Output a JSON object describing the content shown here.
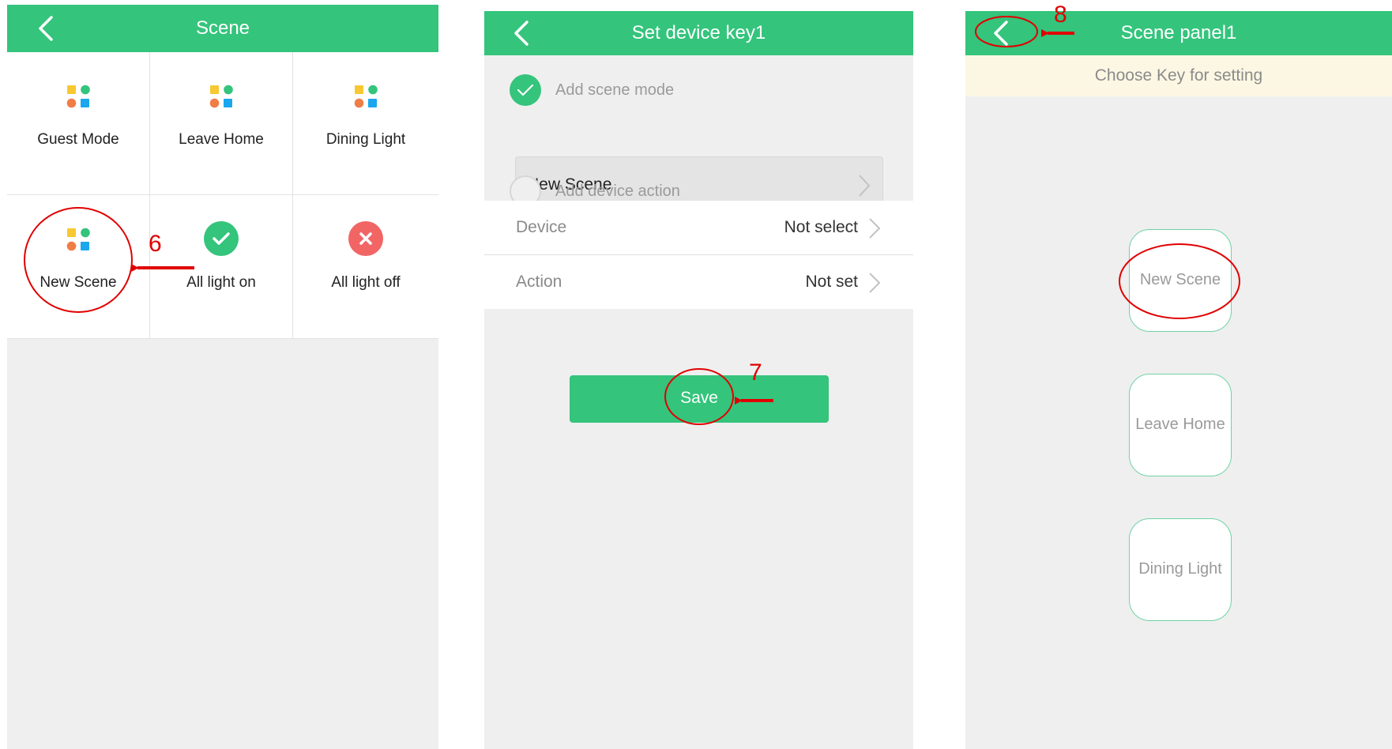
{
  "colors": {
    "brand_green": "#34c47c",
    "alert_red": "#f26565",
    "annotation_red": "#e00000",
    "hint_bg": "#fcf7e3"
  },
  "screen1": {
    "title": "Scene",
    "back_icon": "chevron-left-icon",
    "tiles": [
      {
        "label": "Guest Mode",
        "icon": "scene-grid-icon"
      },
      {
        "label": "Leave Home",
        "icon": "scene-grid-icon"
      },
      {
        "label": "Dining Light",
        "icon": "scene-grid-icon"
      },
      {
        "label": "New Scene",
        "icon": "scene-grid-icon"
      },
      {
        "label": "All light on",
        "icon": "check-circle-icon"
      },
      {
        "label": "All light off",
        "icon": "x-circle-icon"
      }
    ]
  },
  "screen2": {
    "title": "Set device key1",
    "add_scene_label": "Add scene mode",
    "add_scene_checked": true,
    "scene_value": "New Scene",
    "add_device_label": "Add device action",
    "add_device_checked": false,
    "device_label": "Device",
    "device_value": "Not select",
    "action_label": "Action",
    "action_value": "Not set",
    "save_label": "Save"
  },
  "screen3": {
    "title": "Scene panel1",
    "hint": "Choose Key for setting",
    "keys": [
      "New Scene",
      "Leave Home",
      "Dining Light"
    ]
  },
  "annotations": {
    "step6": "6",
    "step7": "7",
    "step8": "8"
  }
}
